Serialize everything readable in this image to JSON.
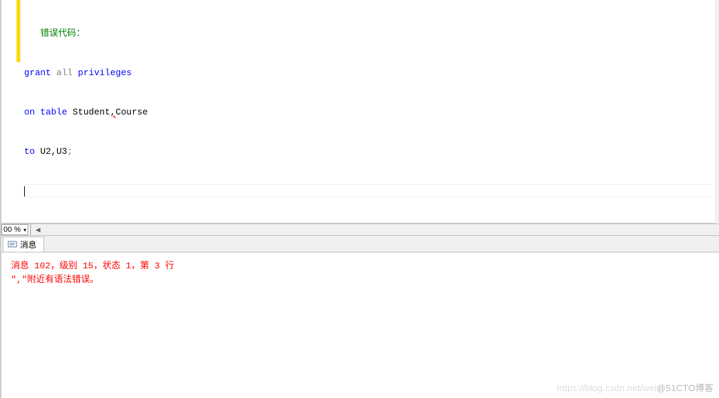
{
  "editor": {
    "comment_fragment": "错误代码：",
    "line1_kw1": "grant",
    "line1_kw2": "all",
    "line1_kw3": "privileges",
    "line2_kw1": "on",
    "line2_kw2": "table",
    "line2_ident1": "Student",
    "line2_comma": ",",
    "line2_ident2": "Course",
    "line3_kw1": "to",
    "line3_ident": "U2,U3",
    "line3_semi": ";"
  },
  "zoom": {
    "level": "00 %"
  },
  "tabs": {
    "messages_label": "消息"
  },
  "messages": {
    "line1": "消息 102，级别 15，状态 1，第 3 行",
    "line2": "\",\"附近有语法错误。"
  },
  "watermark": {
    "faded": "https://blog.csdn.net/wei",
    "text": "@51CTO博客"
  }
}
